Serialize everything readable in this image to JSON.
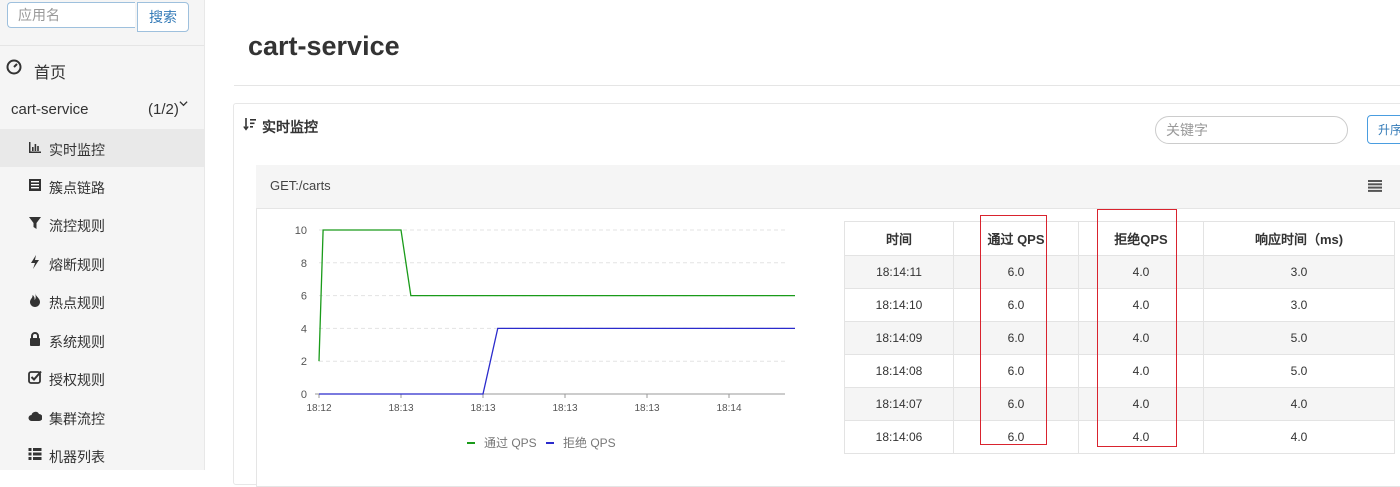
{
  "sidebar": {
    "search_placeholder": "应用名",
    "search_button": "搜索",
    "home_label": "首页",
    "app_name": "cart-service",
    "app_count": "(1/2)",
    "items": [
      {
        "label": "实时监控",
        "icon": "bar-chart-icon",
        "active": true
      },
      {
        "label": "簇点链路",
        "icon": "list-table-icon",
        "active": false
      },
      {
        "label": "流控规则",
        "icon": "filter-icon",
        "active": false
      },
      {
        "label": "熔断规则",
        "icon": "flash-icon",
        "active": false
      },
      {
        "label": "热点规则",
        "icon": "fire-icon",
        "active": false
      },
      {
        "label": "系统规则",
        "icon": "lock-icon",
        "active": false
      },
      {
        "label": "授权规则",
        "icon": "check-square-icon",
        "active": false
      },
      {
        "label": "集群流控",
        "icon": "cloud-icon",
        "active": false
      },
      {
        "label": "机器列表",
        "icon": "th-list-icon",
        "active": false
      }
    ]
  },
  "main": {
    "title": "cart-service",
    "panel_title": "实时监控",
    "keyword_placeholder": "关键字",
    "sort_button": "升序",
    "resource": "GET:/carts"
  },
  "chart_data": {
    "type": "line",
    "x": [
      "18:12",
      "18:13",
      "18:13",
      "18:13",
      "18:13",
      "18:14"
    ],
    "yticks": [
      0,
      2,
      4,
      6,
      8,
      10
    ],
    "ylim": [
      0,
      10
    ],
    "grid": true,
    "legend_position": "bottom",
    "series": [
      {
        "name": "通过 QPS",
        "color": "#1a9b1a",
        "points": [
          [
            0,
            2
          ],
          [
            0.05,
            10
          ],
          [
            1.0,
            10
          ],
          [
            1.12,
            6
          ],
          [
            2.08,
            6
          ],
          [
            3.0,
            6
          ],
          [
            4.0,
            6
          ],
          [
            5.0,
            6
          ],
          [
            5.9,
            6
          ]
        ]
      },
      {
        "name": "拒绝 QPS",
        "color": "#2b2bcc",
        "points": [
          [
            0,
            0
          ],
          [
            1.0,
            0
          ],
          [
            1.12,
            0
          ],
          [
            2.0,
            0
          ],
          [
            2.18,
            4
          ],
          [
            3.0,
            4
          ],
          [
            4.0,
            4
          ],
          [
            5.0,
            4
          ],
          [
            5.9,
            4
          ]
        ]
      }
    ]
  },
  "table": {
    "headers": [
      "时间",
      "通过 QPS",
      "拒绝QPS",
      "响应时间（ms)"
    ],
    "rows": [
      [
        "18:14:11",
        "6.0",
        "4.0",
        "3.0"
      ],
      [
        "18:14:10",
        "6.0",
        "4.0",
        "3.0"
      ],
      [
        "18:14:09",
        "6.0",
        "4.0",
        "5.0"
      ],
      [
        "18:14:08",
        "6.0",
        "4.0",
        "5.0"
      ],
      [
        "18:14:07",
        "6.0",
        "4.0",
        "4.0"
      ],
      [
        "18:14:06",
        "6.0",
        "4.0",
        "4.0"
      ]
    ]
  },
  "colors": {
    "accent": "#337ab7",
    "highlight": "#d9232e",
    "pass": "#1a9b1a",
    "block": "#2b2bcc"
  }
}
